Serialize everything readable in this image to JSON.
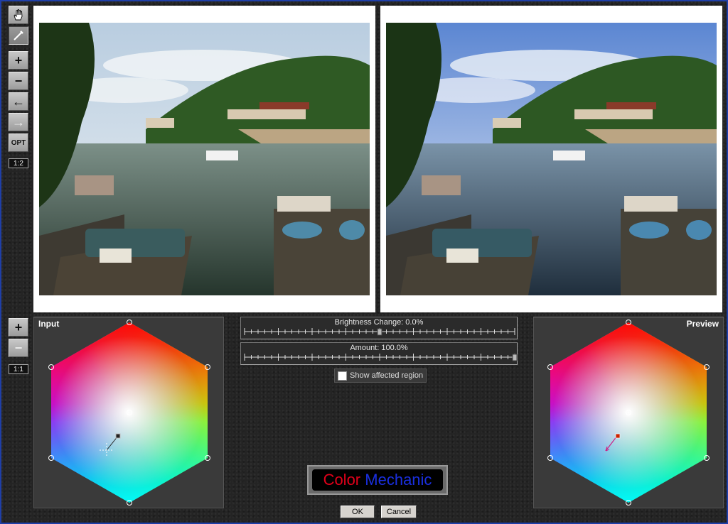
{
  "toolbar": {
    "pan_icon": "hand-icon",
    "eyedropper_icon": "eyedropper-icon",
    "zoom_in": "+",
    "zoom_out": "−",
    "undo": "←",
    "redo": "→",
    "options": "OPT",
    "image_zoom": "1:2"
  },
  "wheel_tools": {
    "zoom_in": "+",
    "zoom_out": "−",
    "zoom": "1:1"
  },
  "input_panel": {
    "title": "Input"
  },
  "preview_panel": {
    "title": "Preview"
  },
  "sliders": {
    "brightness": {
      "label": "Brightness Change: 0.0%",
      "value_percent": 0
    },
    "amount": {
      "label": "Amount: 100.0%",
      "value_percent": 100
    }
  },
  "show_affected_region": {
    "label": "Show affected region",
    "checked": false
  },
  "logo": {
    "word1": "Color",
    "word2": "Mechanic",
    "color1": "#e0001a",
    "color2": "#1a2fe0"
  },
  "buttons": {
    "ok": "OK",
    "cancel": "Cancel"
  },
  "colors": {
    "frame_border": "#1f3fa8",
    "panel": "#3a3a3a",
    "preview_shift_marker": "#cc2200"
  }
}
